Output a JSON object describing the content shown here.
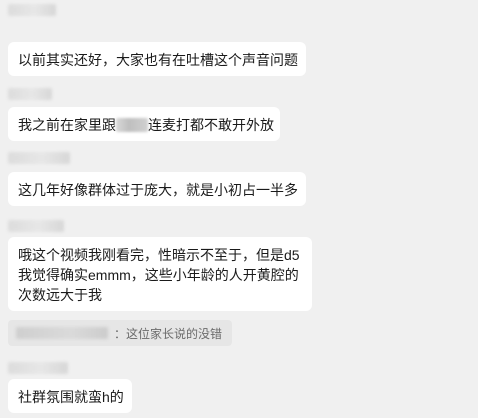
{
  "messages": [
    {
      "text": "以前其实还好，大家也有在吐槽这个声音问题"
    },
    {
      "text_before": "我之前在家里跟",
      "text_after": "连麦打都不敢开外放"
    },
    {
      "text": "这几年好像群体过于庞大，就是小初占一半多"
    },
    {
      "lines": [
        "哦这个视频我刚看完，性暗示不至于，但是d5",
        "我觉得确实emmm，这些小年龄的人开黄腔的",
        "次数远大于我"
      ]
    },
    {
      "text": "社群氛围就蛮h的"
    }
  ],
  "quote": {
    "text": "：这位家长说的没错"
  }
}
